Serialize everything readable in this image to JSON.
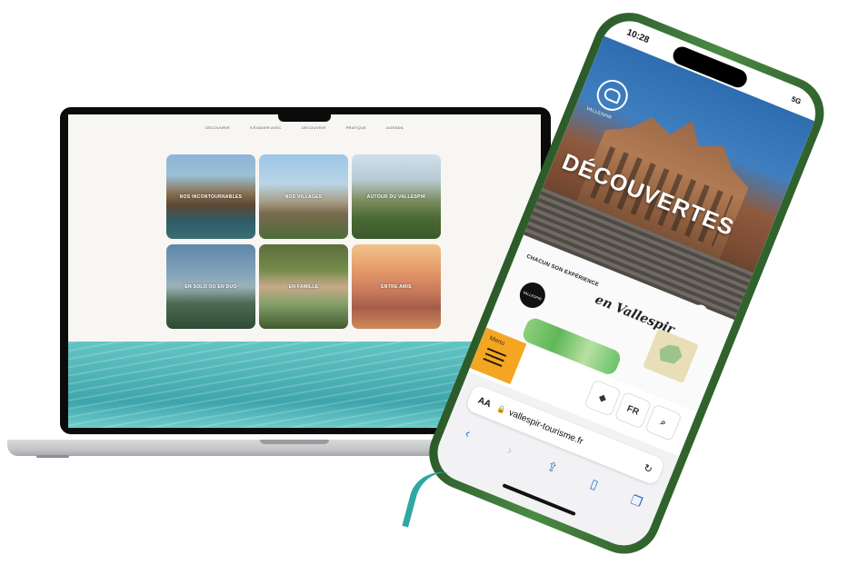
{
  "laptop": {
    "nav": [
      "DÉCOUVRIR",
      "S'ÉVADER AVEC",
      "DÉCOUVRIR",
      "PRATIQUE",
      "AGENDA"
    ],
    "tiles": [
      {
        "label": "NOS INCONTOURNABLES"
      },
      {
        "label": "NOS VILLAGES"
      },
      {
        "label": "AUTOUR DU VALLESPIR"
      },
      {
        "label": "EN SOLO OU EN DUO"
      },
      {
        "label": "EN FAMILLE"
      },
      {
        "label": "ENTRE AMIS"
      }
    ]
  },
  "phone": {
    "time": "10:28",
    "network": "5G",
    "logo_text": "VALLESPIR",
    "hero_title": "DÉCOUVERTES",
    "experience_line": "CHACUN SON EXPÉRIENCE",
    "experience_script": "en Vallespir",
    "badge_text": "VALLESPIR",
    "menu_label": "Menu",
    "lang": "FR",
    "url_aa": "AA",
    "url": "vallespir-tourisme.fr"
  }
}
